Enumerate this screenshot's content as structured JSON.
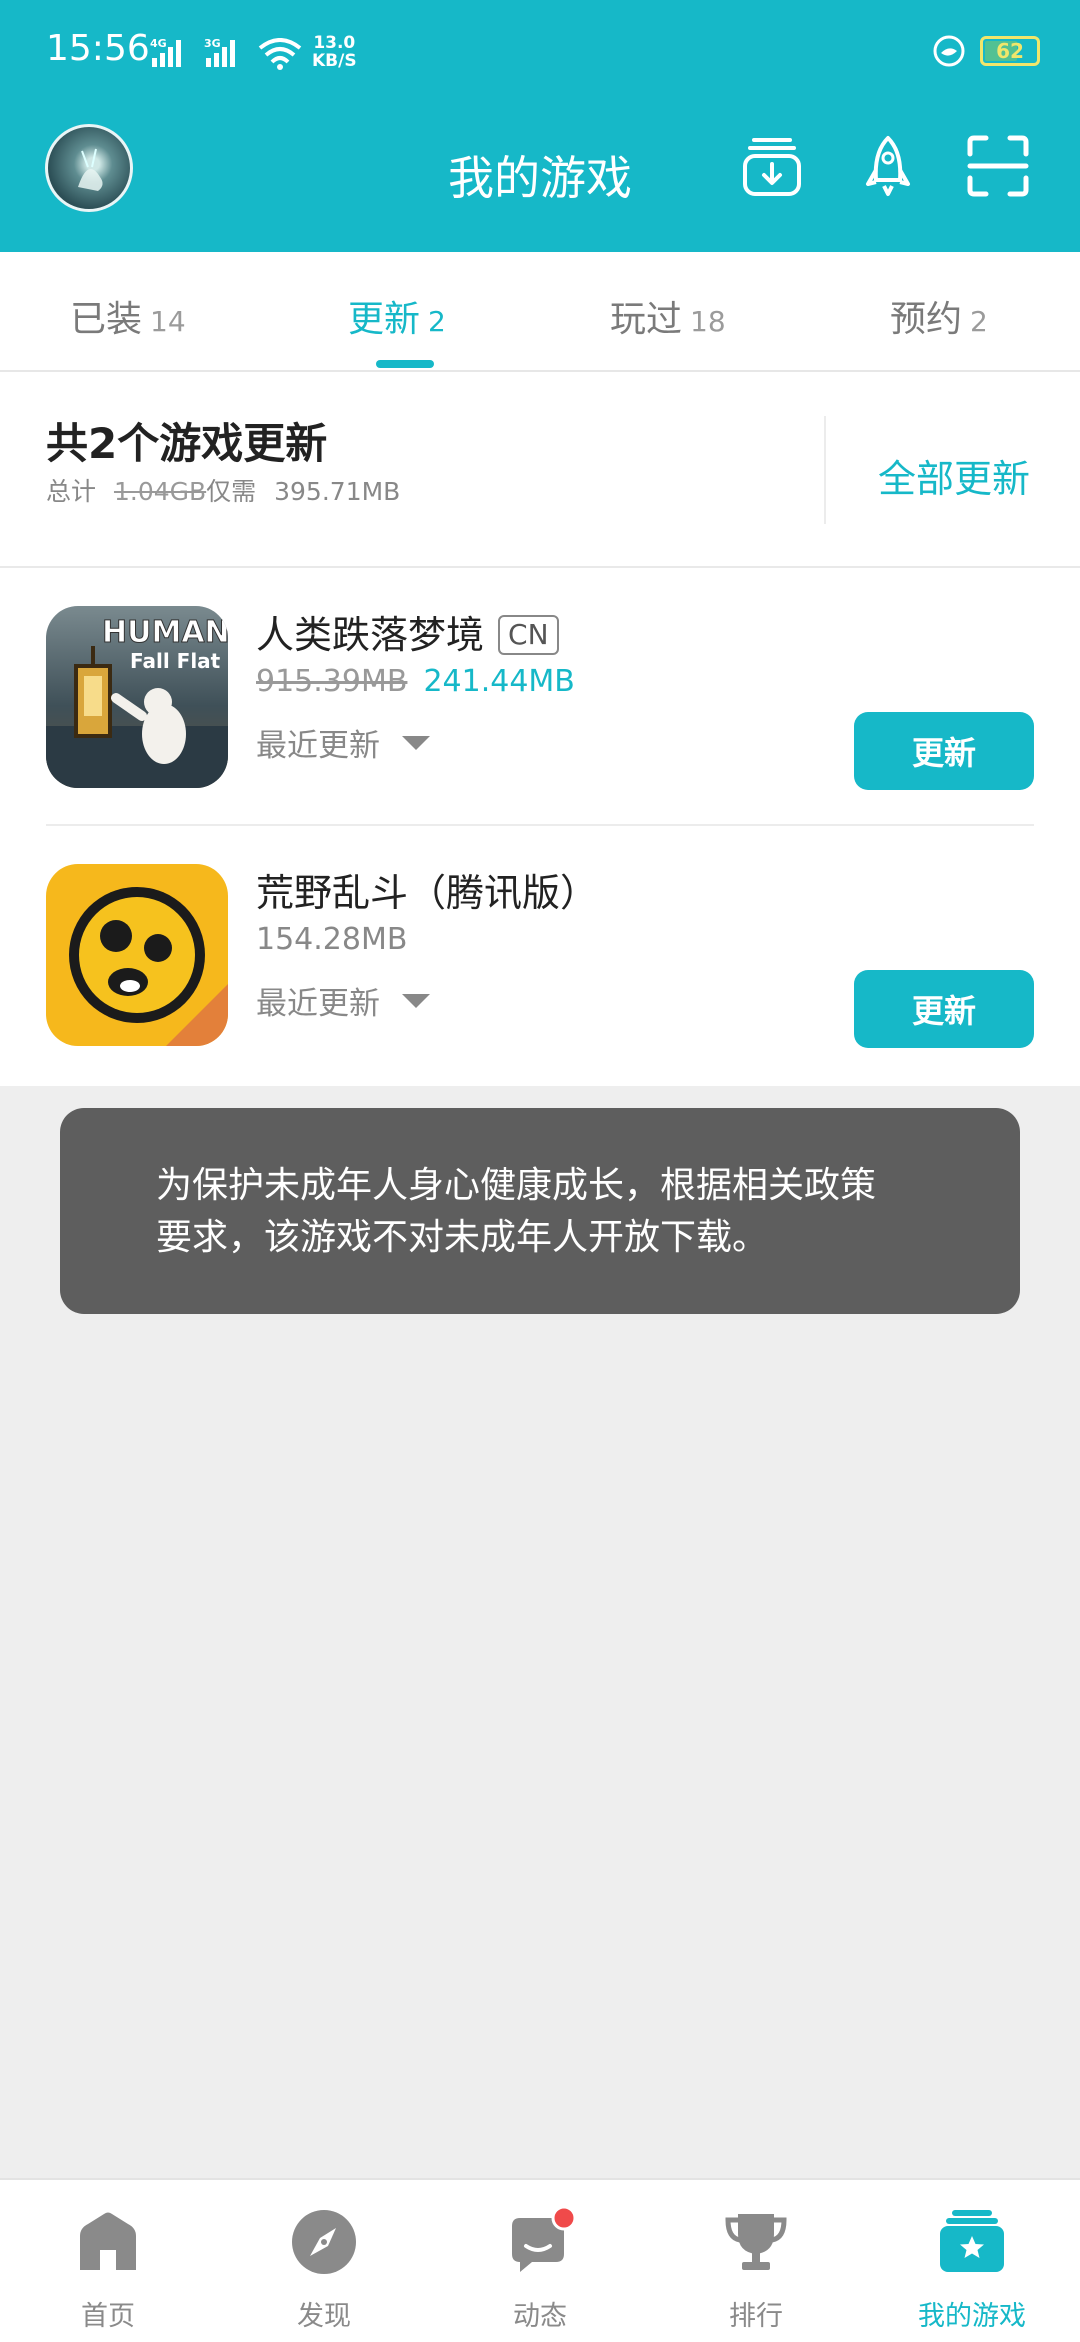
{
  "status_bar": {
    "time": "15:56",
    "signal1": "4G",
    "signal2": "3G",
    "speed_value": "13.0",
    "speed_unit": "KB/S",
    "battery": "62"
  },
  "header": {
    "title": "我的游戏",
    "icons": [
      "download-icon",
      "rocket-icon",
      "scan-icon"
    ]
  },
  "tabs": [
    {
      "label": "已装",
      "count": "14",
      "active": false
    },
    {
      "label": "更新",
      "count": "2",
      "active": true
    },
    {
      "label": "玩过",
      "count": "18",
      "active": false
    },
    {
      "label": "预约",
      "count": "2",
      "active": false
    }
  ],
  "summary": {
    "title": "共2个游戏更新",
    "total_label": "总计",
    "old_size": "1.04GB",
    "need_label": "仅需",
    "new_size": "395.71MB",
    "update_all": "全部更新"
  },
  "games": [
    {
      "name": "人类跌落梦境",
      "tag": "CN",
      "old_size": "915.39MB",
      "new_size": "241.44MB",
      "recent": "最近更新",
      "button": "更新",
      "icon_text_1": "HUMAN",
      "icon_text_2": "Fall Flat"
    },
    {
      "name": "荒野乱斗（腾讯版）",
      "size": "154.28MB",
      "recent": "最近更新",
      "button": "更新"
    }
  ],
  "toast": {
    "line1": "为保护未成年人身心健康成长，根据相关政策",
    "line2": "要求，该游戏不对未成年人开放下载。"
  },
  "bottom_nav": [
    {
      "label": "首页",
      "icon": "home-icon",
      "active": false
    },
    {
      "label": "发现",
      "icon": "compass-icon",
      "active": false
    },
    {
      "label": "动态",
      "icon": "chat-icon",
      "active": false,
      "badge": true
    },
    {
      "label": "排行",
      "icon": "trophy-icon",
      "active": false
    },
    {
      "label": "我的游戏",
      "icon": "my-games-icon",
      "active": true
    }
  ],
  "colors": {
    "accent": "#16b8c8",
    "toast_bg": "#5e5e5e",
    "badge": "#f04a4a"
  }
}
